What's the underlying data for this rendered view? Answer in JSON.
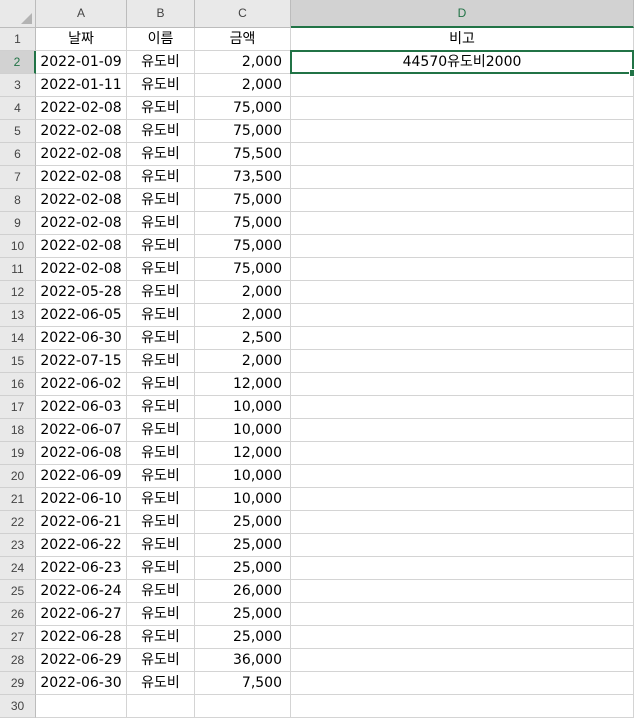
{
  "columns": [
    "A",
    "B",
    "C",
    "D"
  ],
  "selected_column": "D",
  "selected_row": 2,
  "accent_color": "#217346",
  "header_row": {
    "a": "날짜",
    "b": "이름",
    "c": "금액",
    "d": "비고"
  },
  "rows": [
    {
      "a": "2022-01-09",
      "b": "유도비",
      "c": "2,000",
      "d": "44570유도비2000"
    },
    {
      "a": "2022-01-11",
      "b": "유도비",
      "c": "2,000",
      "d": ""
    },
    {
      "a": "2022-02-08",
      "b": "유도비",
      "c": "75,000",
      "d": ""
    },
    {
      "a": "2022-02-08",
      "b": "유도비",
      "c": "75,000",
      "d": ""
    },
    {
      "a": "2022-02-08",
      "b": "유도비",
      "c": "75,500",
      "d": ""
    },
    {
      "a": "2022-02-08",
      "b": "유도비",
      "c": "73,500",
      "d": ""
    },
    {
      "a": "2022-02-08",
      "b": "유도비",
      "c": "75,000",
      "d": ""
    },
    {
      "a": "2022-02-08",
      "b": "유도비",
      "c": "75,000",
      "d": ""
    },
    {
      "a": "2022-02-08",
      "b": "유도비",
      "c": "75,000",
      "d": ""
    },
    {
      "a": "2022-02-08",
      "b": "유도비",
      "c": "75,000",
      "d": ""
    },
    {
      "a": "2022-05-28",
      "b": "유도비",
      "c": "2,000",
      "d": ""
    },
    {
      "a": "2022-06-05",
      "b": "유도비",
      "c": "2,000",
      "d": ""
    },
    {
      "a": "2022-06-30",
      "b": "유도비",
      "c": "2,500",
      "d": ""
    },
    {
      "a": "2022-07-15",
      "b": "유도비",
      "c": "2,000",
      "d": ""
    },
    {
      "a": "2022-06-02",
      "b": "유도비",
      "c": "12,000",
      "d": ""
    },
    {
      "a": "2022-06-03",
      "b": "유도비",
      "c": "10,000",
      "d": ""
    },
    {
      "a": "2022-06-07",
      "b": "유도비",
      "c": "10,000",
      "d": ""
    },
    {
      "a": "2022-06-08",
      "b": "유도비",
      "c": "12,000",
      "d": ""
    },
    {
      "a": "2022-06-09",
      "b": "유도비",
      "c": "10,000",
      "d": ""
    },
    {
      "a": "2022-06-10",
      "b": "유도비",
      "c": "10,000",
      "d": ""
    },
    {
      "a": "2022-06-21",
      "b": "유도비",
      "c": "25,000",
      "d": ""
    },
    {
      "a": "2022-06-22",
      "b": "유도비",
      "c": "25,000",
      "d": ""
    },
    {
      "a": "2022-06-23",
      "b": "유도비",
      "c": "25,000",
      "d": ""
    },
    {
      "a": "2022-06-24",
      "b": "유도비",
      "c": "26,000",
      "d": ""
    },
    {
      "a": "2022-06-27",
      "b": "유도비",
      "c": "25,000",
      "d": ""
    },
    {
      "a": "2022-06-28",
      "b": "유도비",
      "c": "25,000",
      "d": ""
    },
    {
      "a": "2022-06-29",
      "b": "유도비",
      "c": "36,000",
      "d": ""
    },
    {
      "a": "2022-06-30",
      "b": "유도비",
      "c": "7,500",
      "d": ""
    },
    {
      "a": "",
      "b": "",
      "c": "",
      "d": ""
    }
  ]
}
